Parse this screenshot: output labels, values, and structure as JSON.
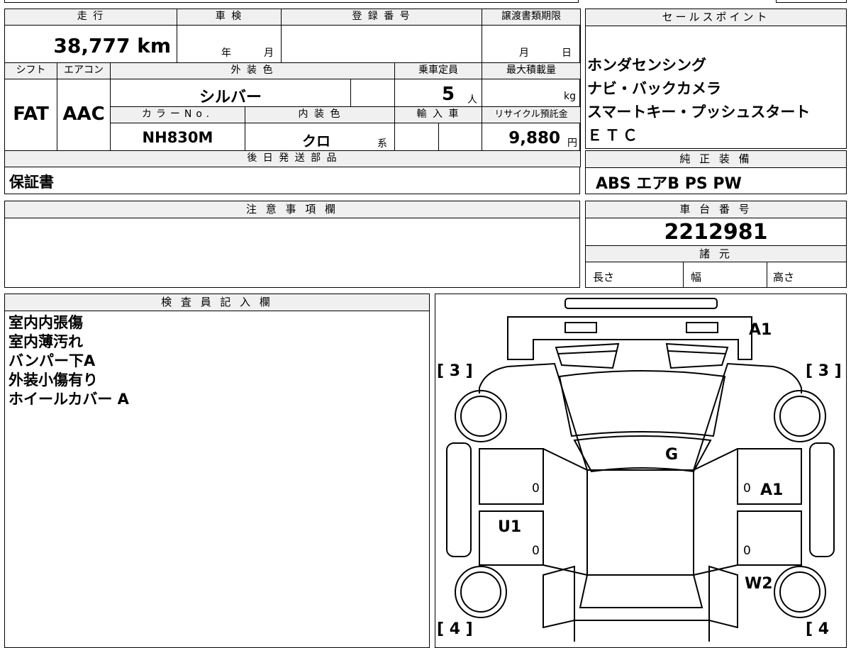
{
  "top": {
    "mileage_label": "走 行",
    "mileage_value": "38,777 km",
    "inspection_label": "車 検",
    "inspection_year": "年",
    "inspection_month": "月",
    "registration_label": "登 録 番 号",
    "transfer_label": "譲渡書類期限",
    "transfer_month": "月",
    "transfer_day": "日",
    "shift_label": "シフト",
    "shift_value": "FAT",
    "aircon_label": "エアコン",
    "aircon_value": "AAC",
    "exterior_label": "外 装 色",
    "exterior_value": "シルバー",
    "capacity_label": "乗車定員",
    "capacity_value": "5",
    "capacity_unit": "人",
    "load_label": "最大積載量",
    "load_unit": "kg",
    "color_no_label": "カラーNo.",
    "color_no_value": "NH830M",
    "interior_label": "内 装 色",
    "interior_value": "クロ",
    "interior_unit": "系",
    "import_label": "輸 入 車",
    "recycle_label": "リサイクル預託金",
    "recycle_value": "9,880",
    "recycle_unit": "円",
    "later_label": "後 日 発 送 部 品",
    "later_value": "保証書"
  },
  "sales": {
    "label": "セールスポイント",
    "lines": [
      "ホンダセンシング",
      "ナビ・バックカメラ",
      "スマートキー・プッシュスタート",
      "ＥＴＣ"
    ]
  },
  "genuine": {
    "label": "純 正 装 備",
    "value": "ABS エアB PS PW"
  },
  "notes": {
    "label": "注 意 事 項 欄"
  },
  "chassis": {
    "label": "車 台 番 号",
    "value": "2212981",
    "spec_label": "諸 元",
    "length_label": "長さ",
    "width_label": "幅",
    "height_label": "高さ"
  },
  "inspector": {
    "label": "検 査 員 記 入 欄",
    "lines": [
      "室内内張傷",
      "室内薄汚れ",
      "バンパー下A",
      "外装小傷有り",
      "ホイールカバー A"
    ]
  },
  "diagram": {
    "front_left_bracket": "[ 3 ]",
    "front_right_bracket": "[ 3 ]",
    "rear_left_bracket": "[ 4 ]",
    "rear_right_bracket": "[ 4",
    "label_a1_front": "A1",
    "label_g": "G",
    "label_a1_side": "A1",
    "label_u1": "U1",
    "label_w2": "W2",
    "zero": "0"
  }
}
